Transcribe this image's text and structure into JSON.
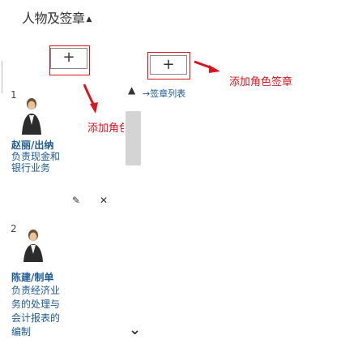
{
  "page": {
    "title": "人物及签章",
    "title_caret": "▲"
  },
  "toolbar": {
    "add_role_button": "+",
    "add_signature_button": "+"
  },
  "annotations": {
    "add_role": "添加角色",
    "add_signature": "添加角色签章",
    "signature_list": "签章列表",
    "arrow_label": "→"
  },
  "roles": [
    {
      "index": "1",
      "name": "赵丽/出纳",
      "desc_lines": [
        "负责现金和",
        "银行业务"
      ]
    },
    {
      "index": "2",
      "name": "陈建/制单",
      "desc_lines": [
        "负责经济业",
        "务的处理与",
        "会计报表的",
        "编制"
      ]
    }
  ],
  "role_tools": {
    "edit_icon": "✎",
    "delete_icon": "✕"
  },
  "scroll": {
    "up": "▲",
    "down": "⌄"
  },
  "colors": {
    "accent_red": "#d9141e",
    "link_blue": "#1d5a93",
    "scroll_thumb": "#d4d4d4"
  }
}
